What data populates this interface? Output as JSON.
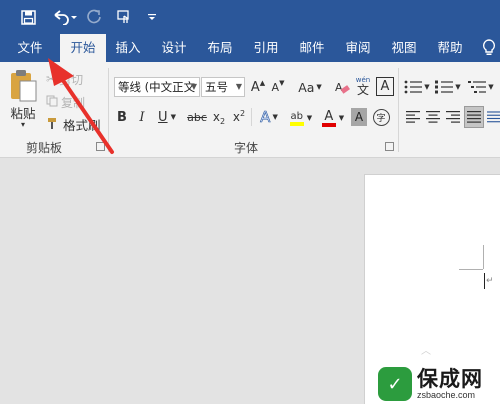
{
  "colors": {
    "accent": "#2b579a",
    "ribbon_bg": "#f3f3f3",
    "font_color_red": "#e00000",
    "highlight_yellow": "#ffff00",
    "arrow_red": "#e8312b"
  },
  "qat": {
    "save_icon": "save-icon",
    "undo_icon": "undo-icon",
    "redo_icon": "redo-icon",
    "touch_icon": "touch-mode-icon",
    "customize_icon": "customize-qat-icon"
  },
  "tabs": [
    "文件",
    "开始",
    "插入",
    "设计",
    "布局",
    "引用",
    "邮件",
    "审阅",
    "视图",
    "帮助"
  ],
  "tell_me_icon": "lightbulb-icon",
  "clipboard": {
    "paste": "粘贴",
    "cut": "剪切",
    "copy": "复制",
    "format_painter": "格式刷",
    "group_label": "剪贴板"
  },
  "font": {
    "font_name": "等线 (中文正文",
    "font_size": "五号",
    "grow": "A",
    "shrink": "A",
    "change_case": "Aa",
    "pinyin_top": "wén",
    "pinyin_char": "文",
    "char_border": "A",
    "bold": "B",
    "italic": "I",
    "underline": "U",
    "strikethrough": "abc",
    "subscript_base": "x",
    "subscript": "2",
    "superscript_base": "x",
    "superscript": "2",
    "effects": "A",
    "highlight_text": "ab",
    "font_color_text": "A",
    "shading": "A",
    "enclose_char": "字",
    "group_label": "字体"
  },
  "paragraph_mark": "↵",
  "watermark": {
    "badge": "✓",
    "main": "保成网",
    "sub": "zsbaoche.com"
  }
}
